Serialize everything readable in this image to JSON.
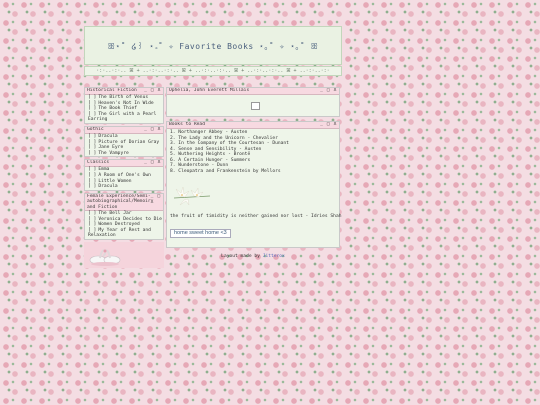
{
  "header": {
    "title": "ꕥ⋆˚ ໒꒱ ⋆｡˚ ✧ Favorite Books ⋆｡˚ ✧ ⋆｡˚ ꕥ"
  },
  "navbar": {
    "text": "·:·..·:·.. ꕤ + ..·:·..·:·.. ꕤ + ..·:·..·:·.. ꕤ + ..·:·..·:·.. ꕤ + ..·:·..·:·"
  },
  "sidebar": {
    "sections": [
      {
        "title": "Historical Fiction",
        "items": [
          "The Birth of Venus",
          "Heaven's Not In Wide",
          "The Book Thief",
          "The Girl with a Pearl Earring"
        ]
      },
      {
        "title": "Gothic",
        "items": [
          "Dracula",
          "Picture of Dorian Gray",
          "Jane Eyre",
          "The Vampyre"
        ]
      },
      {
        "title": "Classics",
        "items": [
          "Emma",
          "A Room of One's Own",
          "Little Women",
          "Dracula"
        ]
      },
      {
        "title": "Female Experience/Semi-autobiographical/Memoir and Fiction",
        "items": [
          "The Bell Jar",
          "Veronica Decides to Die",
          "Women Destroyed",
          "My Year of Rest and Relaxation"
        ]
      }
    ],
    "checkbox": "[ ]",
    "controls": "_ □ X"
  },
  "photo_window": {
    "title": "Ophelia, John Everett Millais",
    "controls": "_ □ X"
  },
  "books_window": {
    "title": "Books to Read",
    "controls": "_ □ X",
    "books": [
      "1. Northanger Abbey - Austen",
      "2. The Lady and the Unicorn - Chevalier",
      "3. In the Company of the Courtesan - Dunant",
      "4. Sense and Sensibility - Austen",
      "5. Wuthering Heights - Brontë",
      "6. A Certain Hunger - Summers",
      "7. Wunderstone - Dunn",
      "8. Cleopatra and Frankenstein by Mellors"
    ],
    "quote": "the fruit of timidity is neither gained nor lost - Idries Shah",
    "home_button": "home sweet home <3"
  },
  "footer": {
    "prefix": "Layout made by",
    "credit": "Jitterox"
  }
}
